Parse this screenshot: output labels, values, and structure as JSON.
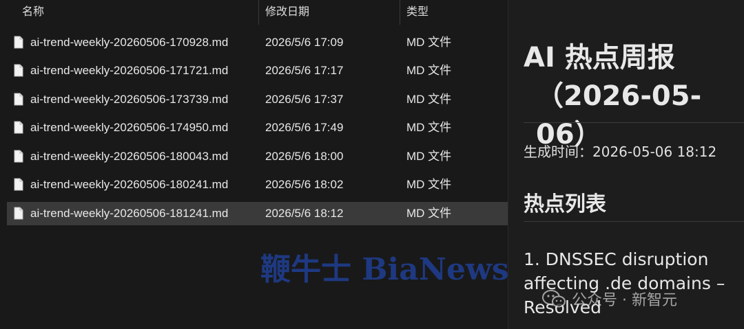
{
  "explorer": {
    "columns": {
      "name": "名称",
      "modified": "修改日期",
      "type": "类型"
    },
    "files": [
      {
        "name": "ai-trend-weekly-20260506-170928.md",
        "modified": "2026/5/6 17:09",
        "type": "MD 文件"
      },
      {
        "name": "ai-trend-weekly-20260506-171721.md",
        "modified": "2026/5/6 17:17",
        "type": "MD 文件"
      },
      {
        "name": "ai-trend-weekly-20260506-173739.md",
        "modified": "2026/5/6 17:37",
        "type": "MD 文件"
      },
      {
        "name": "ai-trend-weekly-20260506-174950.md",
        "modified": "2026/5/6 17:49",
        "type": "MD 文件"
      },
      {
        "name": "ai-trend-weekly-20260506-180043.md",
        "modified": "2026/5/6 18:00",
        "type": "MD 文件"
      },
      {
        "name": "ai-trend-weekly-20260506-180241.md",
        "modified": "2026/5/6 18:02",
        "type": "MD 文件"
      },
      {
        "name": "ai-trend-weekly-20260506-181241.md",
        "modified": "2026/5/6 18:12",
        "type": "MD 文件",
        "selected": true
      }
    ]
  },
  "preview": {
    "title_line1": "AI 热点周报",
    "title_line2": "（2026-05-06）",
    "meta": "生成时间：2026-05-06 18:12",
    "section_heading": "热点列表",
    "item_1": "1. DNSSEC disruption affecting .de domains – Resolved"
  },
  "watermarks": {
    "bianews": "鞭牛士 BiaNews",
    "wechat": "公众号 · 新智元"
  },
  "colors": {
    "background": "#191919",
    "selected_row": "#3a3a3a",
    "watermark_blue": "#1f3c8a"
  }
}
